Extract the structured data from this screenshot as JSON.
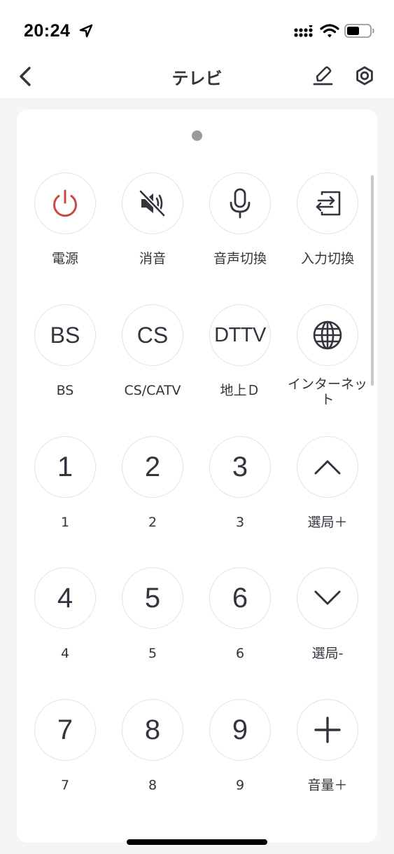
{
  "status_bar": {
    "time": "20:24"
  },
  "nav": {
    "title": "テレビ"
  },
  "buttons": [
    {
      "name": "power",
      "label": "電源"
    },
    {
      "name": "mute",
      "label": "消音"
    },
    {
      "name": "audio-switch",
      "label": "音声切換"
    },
    {
      "name": "input-switch",
      "label": "入力切換"
    },
    {
      "name": "bs",
      "text": "BS",
      "label": "BS"
    },
    {
      "name": "cs",
      "text": "CS",
      "label": "CS/CATV"
    },
    {
      "name": "dttv",
      "text": "DTTV",
      "label": "地上Ｄ"
    },
    {
      "name": "internet",
      "label": "インターネット"
    },
    {
      "name": "num-1",
      "text": "1",
      "label": "1"
    },
    {
      "name": "num-2",
      "text": "2",
      "label": "2"
    },
    {
      "name": "num-3",
      "text": "3",
      "label": "3"
    },
    {
      "name": "channel-up",
      "label": "選局＋"
    },
    {
      "name": "num-4",
      "text": "4",
      "label": "4"
    },
    {
      "name": "num-5",
      "text": "5",
      "label": "5"
    },
    {
      "name": "num-6",
      "text": "6",
      "label": "6"
    },
    {
      "name": "channel-down",
      "label": "選局-"
    },
    {
      "name": "num-7",
      "text": "7",
      "label": "7"
    },
    {
      "name": "num-8",
      "text": "8",
      "label": "8"
    },
    {
      "name": "num-9",
      "text": "9",
      "label": "9"
    },
    {
      "name": "volume-up",
      "label": "音量＋"
    }
  ],
  "colors": {
    "power_red": "#c94a45",
    "icon": "#33343d",
    "circle_border": "#e3e3e3"
  }
}
